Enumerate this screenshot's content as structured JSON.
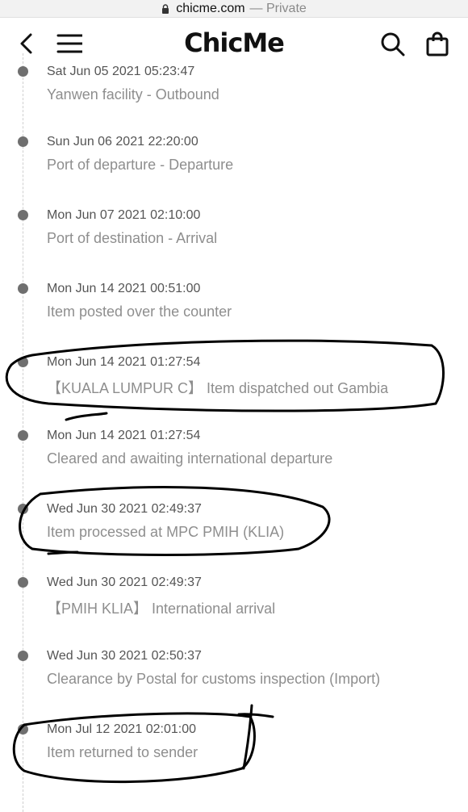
{
  "browser": {
    "url": "chicme.com",
    "mode": "— Private"
  },
  "header": {
    "logo_text": "ChicMe"
  },
  "tracking": {
    "events": [
      {
        "timestamp": "Sat Jun 05 2021 05:23:47",
        "description": "Yanwen facility - Outbound"
      },
      {
        "timestamp": "Sun Jun 06 2021 22:20:00",
        "description": "Port of departure - Departure"
      },
      {
        "timestamp": "Mon Jun 07 2021 02:10:00",
        "description": "Port of destination - Arrival"
      },
      {
        "timestamp": "Mon Jun 14 2021 00:51:00",
        "description": "Item posted over the counter"
      },
      {
        "timestamp": "Mon Jun 14 2021 01:27:54",
        "description": "【KUALA LUMPUR C】 Item dispatched out Gambia"
      },
      {
        "timestamp": "Mon Jun 14 2021 01:27:54",
        "description": "Cleared and awaiting international departure"
      },
      {
        "timestamp": "Wed Jun 30 2021 02:49:37",
        "description": "Item processed at MPC PMIH (KLIA)"
      },
      {
        "timestamp": "Wed Jun 30 2021 02:49:37",
        "description": "【PMIH KLIA】 International arrival"
      },
      {
        "timestamp": "Wed Jun 30 2021 02:50:37",
        "description": "Clearance by Postal for customs inspection (Import)"
      },
      {
        "timestamp": "Mon Jul 12 2021 02:01:00",
        "description": "Item returned to sender"
      }
    ]
  },
  "icons": [
    "lock-icon",
    "back-arrow-icon",
    "hamburger-menu-icon",
    "search-icon",
    "shopping-bag-icon"
  ],
  "colors": {
    "timestamp": "#555555",
    "description": "#8e8e8e",
    "dot": "#6f6f6f",
    "annotation_ink": "#000000"
  }
}
